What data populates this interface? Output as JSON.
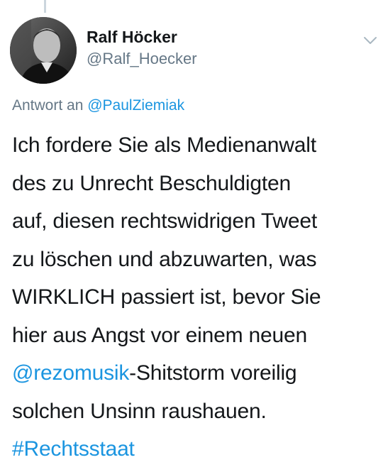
{
  "tweet": {
    "author": {
      "display_name": "Ralf Höcker",
      "handle": "@Ralf_Hoecker"
    },
    "reply_prefix": "Antwort an ",
    "reply_to": "@PaulZiemiak",
    "lines": {
      "l1": "Ich fordere Sie als Medienanwalt",
      "l2": "des zu Unrecht Beschuldigten",
      "l3": "auf, diesen rechtswidrigen Tweet",
      "l4": "zu löschen und abzuwarten, was",
      "l5": "WIRKLICH passiert ist, bevor Sie",
      "l6": "hier aus Angst vor einem neuen",
      "l7_mention": "@rezomusik",
      "l7_rest": "-Shitstorm voreilig",
      "l8": "solchen Unsinn raushauen.",
      "l9_hashtag": "#Rechtsstaat"
    },
    "icons": {
      "avatar": "profile-photo",
      "menu": "chevron-down-icon"
    }
  },
  "colors": {
    "link": "#1b95e0",
    "secondary_text": "#657786",
    "primary_text": "#14171a"
  }
}
